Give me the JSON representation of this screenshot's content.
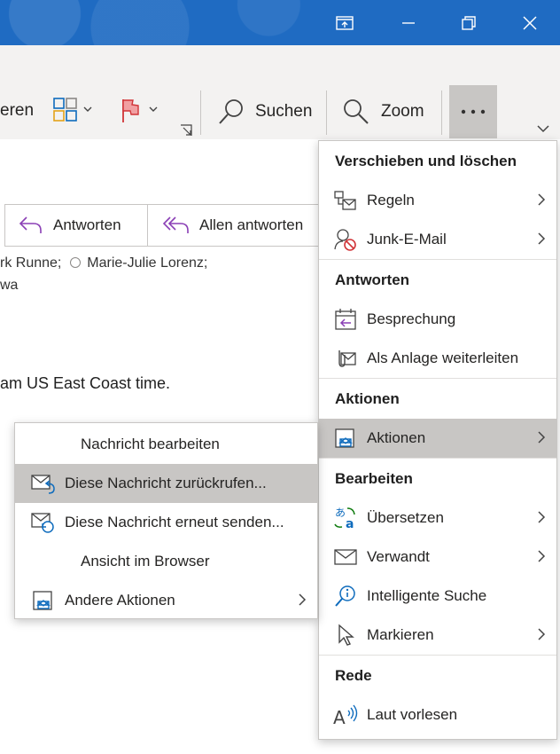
{
  "titlebar": {
    "buttons": [
      "restore-ribbon",
      "minimize",
      "restore",
      "close"
    ]
  },
  "ribbon": {
    "partial_label": "eren",
    "search_label": "Suchen",
    "zoom_label": "Zoom",
    "more_label": "..."
  },
  "reply": {
    "reply_label": "Antworten",
    "reply_all_label": "Allen antworten"
  },
  "message": {
    "recipients_line": "rk Runne;",
    "recipient2": "Marie-Julie Lorenz;",
    "recipients_line2": "wa",
    "body_fragment": "am US East Coast time."
  },
  "main_menu": {
    "sections": [
      {
        "title": "Verschieben und löschen",
        "items": [
          {
            "label": "Regeln",
            "icon": "rules-icon",
            "submenu": true
          },
          {
            "label": "Junk-E-Mail",
            "icon": "junk-icon",
            "submenu": true
          }
        ]
      },
      {
        "title": "Antworten",
        "items": [
          {
            "label": "Besprechung",
            "icon": "meeting-icon",
            "submenu": false
          },
          {
            "label": "Als Anlage weiterleiten",
            "icon": "attachment-icon",
            "submenu": false
          }
        ]
      },
      {
        "title": "Aktionen",
        "items": [
          {
            "label": "Aktionen",
            "icon": "actions-icon",
            "submenu": true,
            "selected": true
          }
        ]
      },
      {
        "title": "Bearbeiten",
        "items": [
          {
            "label": "Übersetzen",
            "icon": "translate-icon",
            "submenu": true
          },
          {
            "label": "Verwandt",
            "icon": "related-icon",
            "submenu": true
          },
          {
            "label": "Intelligente Suche",
            "icon": "smart-lookup-icon",
            "submenu": false
          },
          {
            "label": "Markieren",
            "icon": "select-icon",
            "submenu": true
          }
        ]
      },
      {
        "title": "Rede",
        "items": [
          {
            "label": "Laut vorlesen",
            "icon": "read-aloud-icon",
            "submenu": false
          }
        ]
      }
    ]
  },
  "actions_submenu": {
    "items": [
      {
        "label": "Nachricht bearbeiten"
      },
      {
        "label": "Diese Nachricht zurückrufen...",
        "selected": true
      },
      {
        "label": "Diese Nachricht erneut senden..."
      },
      {
        "label": "Ansicht im Browser"
      },
      {
        "label": "Andere Aktionen",
        "submenu": true
      }
    ]
  },
  "colors": {
    "titlebar": "#1f6bc2",
    "ribbon": "#f3f2f1",
    "selected": "#c8c6c4",
    "accent": "#0f6cbd",
    "purple": "#8a3fb5",
    "red": "#d13438"
  }
}
